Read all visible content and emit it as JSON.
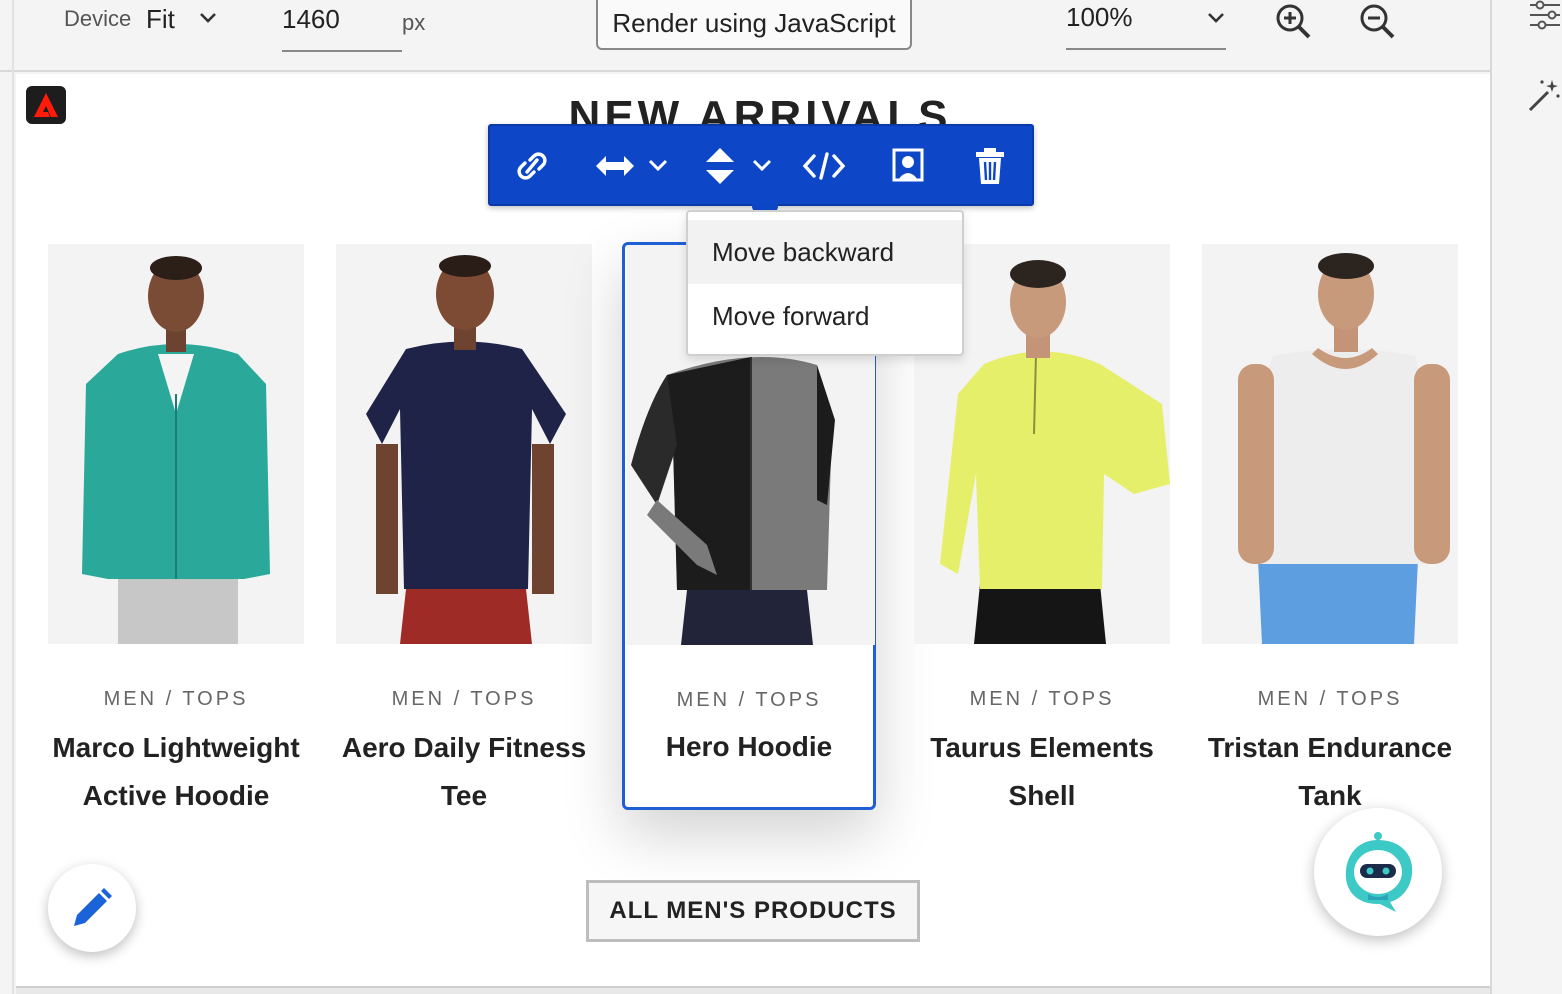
{
  "topbar": {
    "device_label": "Device",
    "device_value": "Fit",
    "width_value": "1460",
    "width_unit": "px",
    "render_button_label": "Render using JavaScript",
    "zoom_value": "100%"
  },
  "canvas": {
    "heading": "NEW ARRIVALS"
  },
  "toolbar": {
    "tools": [
      "link-icon",
      "width-icon",
      "height-icon",
      "code-icon",
      "image-icon",
      "trash-icon"
    ]
  },
  "dropdown": {
    "items": [
      {
        "label": "Move backward",
        "highlighted": true
      },
      {
        "label": "Move forward",
        "highlighted": false
      }
    ]
  },
  "products": [
    {
      "category": "MEN / TOPS",
      "name_line1": "Marco Lightweight",
      "name_line2": "Active Hoodie"
    },
    {
      "category": "MEN / TOPS",
      "name_line1": "Aero Daily Fitness",
      "name_line2": "Tee"
    },
    {
      "category": "MEN / TOPS",
      "name_line1": "Hero Hoodie",
      "name_line2": ""
    },
    {
      "category": "MEN / TOPS",
      "name_line1": "Taurus Elements",
      "name_line2": "Shell"
    },
    {
      "category": "MEN / TOPS",
      "name_line1": "Tristan Endurance",
      "name_line2": "Tank"
    }
  ],
  "all_products_button": "ALL MEN'S PRODUCTS",
  "colors": {
    "accent": "#0d47c8",
    "selection": "#1f5fd6"
  }
}
